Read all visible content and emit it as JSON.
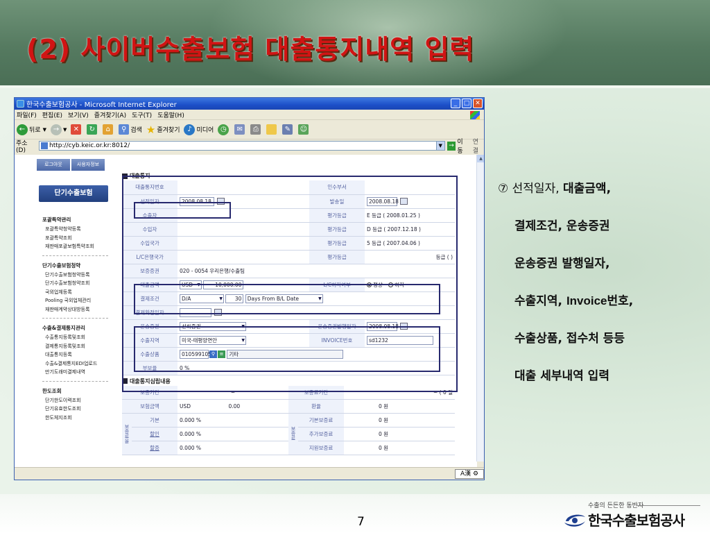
{
  "slide": {
    "title": "(2) 사이버수출보험 대출통지내역 입력",
    "page_number": "7",
    "logo_tagline": "수출의 든든한 동반자",
    "logo_text": "한국수출보험공사"
  },
  "browser": {
    "window_title": "한국수출보험공사 - Microsoft Internet Explorer",
    "menu": [
      "파일(F)",
      "편집(E)",
      "보기(V)",
      "즐겨찾기(A)",
      "도구(T)",
      "도움말(H)"
    ],
    "toolbar": {
      "back": "뒤로",
      "search": "검색",
      "favorites": "즐겨찾기",
      "media": "미디어"
    },
    "address_label": "주소(D)",
    "address_value": "http://cyb.keic.or.kr:8012/",
    "go_label": "이동",
    "links_label": "연결",
    "ime_label": "A漢"
  },
  "nav": {
    "login_btn": "로그아웃",
    "userinfo_btn": "사용자정보",
    "main_btn": "단기수출보험",
    "groups": [
      {
        "title": "포괄특약관리",
        "items": [
          "포괄특약청약등록",
          "포괄특약조회",
          "재판매포괄보험특약조회"
        ]
      },
      {
        "title": "단기수출보험청약",
        "items": [
          "단기수출보험청약등록",
          "단기수출보험청약조회",
          "국외업체등록",
          "Pooling 국외업체관리",
          "재판매계약상대방등록"
        ]
      },
      {
        "title": "수출&결제통지관리",
        "items": [
          "수출통지등록및조회",
          "결제통지등록및조회",
          "대출통지등록",
          "수출&결제통지EDI업로드",
          "만기도래미결제내역"
        ]
      },
      {
        "title": "한도조회",
        "items": [
          "단기한도이력조회",
          "단기유효한도조회",
          "한도체지조회"
        ]
      }
    ]
  },
  "form": {
    "section1": "대출통지",
    "section2": "대출통지심립내용",
    "labels": {
      "notice_no": "대출통지번호",
      "recv_dept": "인수부서",
      "pay_date": "선적일자",
      "issue_date": "발송일",
      "exporter": "수출자",
      "grade1": "평가등급",
      "importer": "수입자",
      "grade2": "평가등급",
      "import_country": "수입국가",
      "grade3": "평가등급",
      "lc_country": "L/C은행국가",
      "grade4": "평가등급",
      "guarantee_no": "보증증권",
      "loan_amount": "대출금액",
      "lc_defect": "L/C하자여부",
      "pay_terms": "결제조건",
      "pay_confirm": "결제확정일자",
      "shipping_doc": "운송증권",
      "doc_issue_date": "운송증권발행일자",
      "export_region": "수출지역",
      "invoice_no": "INVOICE번호",
      "export_goods": "수출상품",
      "coverage": "부보율"
    },
    "values": {
      "pay_date": "2008.08.18",
      "issue_date": "2008.08.18",
      "grade1": "E    등급 ( 2008.01.25  )",
      "grade2": "D    등급 ( 2007.12.18  )",
      "grade3": "5    등급 ( 2007.04.06  )",
      "grade4": "등급 (              )",
      "guarantee_no": "020 - 0054     우리은행/수출팀",
      "currency": "USD",
      "loan_amount": "10,000.00",
      "lc_normal": "정상",
      "lc_defect": "하자",
      "pay_terms": "D/A",
      "days": "30",
      "days_basis": "Days From B/L Date",
      "shipping_doc": "선하증권",
      "doc_issue_date": "2008.08.18",
      "export_region": "미국-태평양연안",
      "invoice_no": "sd1232",
      "goods_code": "010599105",
      "goods_name": "기타",
      "coverage": "0 %"
    },
    "section2_rows": {
      "period_label": "보증기간",
      "period_value": "~",
      "premium_period_label": "보증료기간",
      "premium_period_value": "~          (      0 일",
      "insured_amount_label": "보험금액",
      "insured_currency": "USD",
      "insured_amount": "0.00",
      "exchange_label": "환율",
      "exchange_value": "0 원",
      "rate_group": "보증료율",
      "basic_label": "기본",
      "basic_value": "0.000 %",
      "discount_label": "할인",
      "discount_value": "0.000 %",
      "surcharge_label": "할증",
      "surcharge_value": "0.000 %",
      "fee_group": "보증료",
      "basic_fee_label": "기본보증료",
      "basic_fee_value": "0 원",
      "extra_fee_label": "추가보증료",
      "extra_fee_value": "0 원",
      "support_fee_label": "지원보증료",
      "support_fee_value": "0 원"
    }
  },
  "notes": {
    "line1_prefix": "⑦ 선적일자, ",
    "line1_bold": "대출금액,",
    "line2": "결제조건,  운송증권",
    "line3": "운송증권 발행일자,",
    "line4_a": "수출지역, ",
    "line4_b": "Invoice",
    "line4_c": "번호,",
    "line5": "수출상품, 접수처 등등",
    "line6": "대출 세부내역 입력"
  },
  "colors": {
    "title_red": "#d11414",
    "highlight_navy": "#27296e",
    "header_green": "#557a60"
  }
}
